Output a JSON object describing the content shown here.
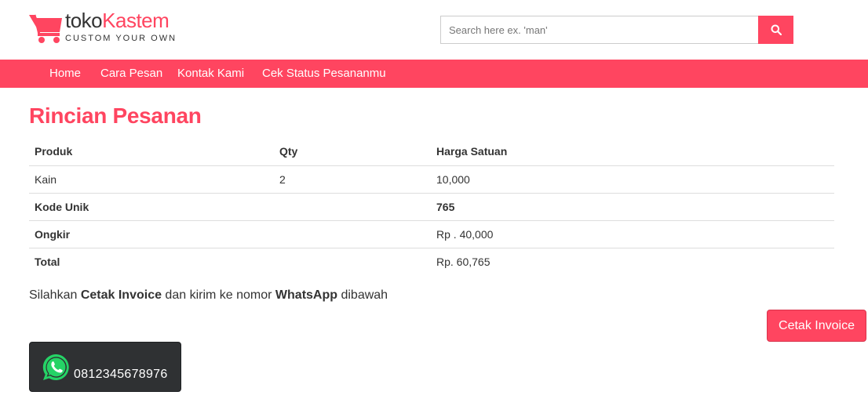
{
  "header": {
    "logo_part1": "toko",
    "logo_part2": "Kastem",
    "logo_tagline": "CUSTOM YOUR OWN",
    "search_placeholder": "Search here ex. 'man'",
    "search_value": "",
    "search_icon": "search-icon"
  },
  "nav": {
    "items": [
      {
        "label": "Home"
      },
      {
        "label": "Cara Pesan"
      },
      {
        "label": "Kontak Kami"
      },
      {
        "label": "Cek Status Pesananmu"
      }
    ]
  },
  "main": {
    "title": "Rincian Pesanan",
    "table": {
      "headers": [
        "Produk",
        "Qty",
        "Harga Satuan"
      ],
      "rows": [
        {
          "produk": "Kain",
          "qty": "2",
          "harga": "10,000"
        }
      ],
      "kode_unik_label": "Kode Unik",
      "kode_unik_value": "765",
      "ongkir_label": "Ongkir",
      "ongkir_value": "Rp . 40,000",
      "total_label": "Total",
      "total_value": "Rp. 60,765"
    },
    "instruction": {
      "part1": "Silahkan ",
      "bold1": "Cetak Invoice",
      "part2": " dan kirim ke nomor ",
      "bold2": "WhatsApp",
      "part3": " dibawah"
    },
    "invoice_button": "Cetak Invoice",
    "whatsapp": {
      "icon": "whatsapp-icon",
      "number": "0812345678976"
    }
  },
  "colors": {
    "accent": "#ff4560",
    "text": "#333333",
    "whatsapp_green": "#25d366",
    "whatsapp_box": "#2f3133"
  }
}
